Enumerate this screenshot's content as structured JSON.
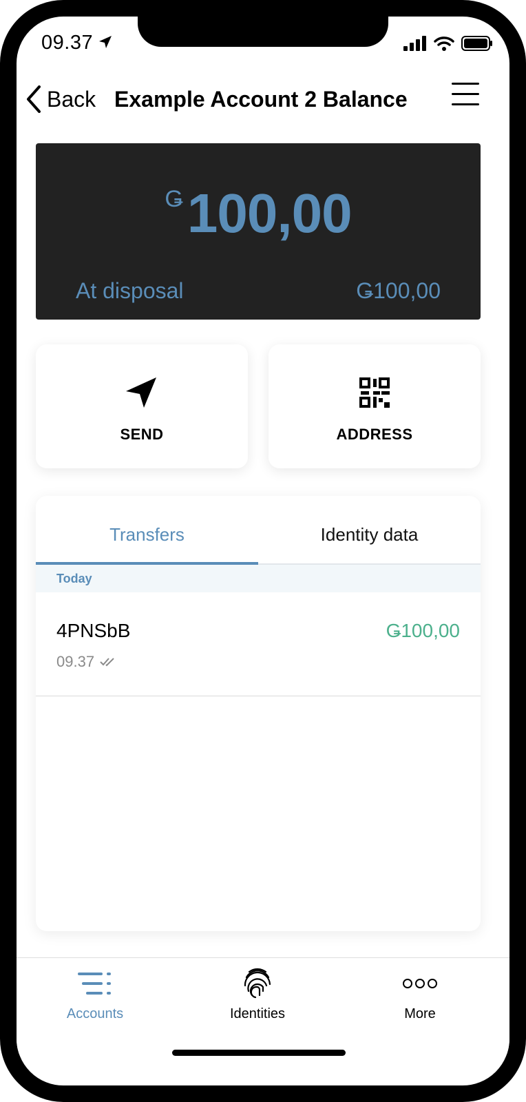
{
  "status_bar": {
    "time": "09.37"
  },
  "header": {
    "back_label": "Back",
    "title": "Example Account 2 Balance"
  },
  "balance": {
    "currency_symbol": "Ǥ",
    "amount": "100,00",
    "at_disposal_label": "At disposal",
    "at_disposal_value": "Ǥ100,00"
  },
  "actions": {
    "send_label": "SEND",
    "address_label": "ADDRESS"
  },
  "tabs": [
    {
      "label": "Transfers",
      "active": true
    },
    {
      "label": "Identity data",
      "active": false
    }
  ],
  "transfers": {
    "section_label": "Today",
    "items": [
      {
        "name": "4PNSbB",
        "time": "09.37",
        "amount": "Ǥ100,00"
      }
    ]
  },
  "tabbar": [
    {
      "label": "Accounts",
      "icon": "accounts-list-icon",
      "active": true
    },
    {
      "label": "Identities",
      "icon": "fingerprint-icon",
      "active": false
    },
    {
      "label": "More",
      "icon": "more-dots-icon",
      "active": false
    }
  ],
  "colors": {
    "accent": "#5a8db8",
    "positive": "#4cb08c",
    "card_bg": "#222222"
  }
}
